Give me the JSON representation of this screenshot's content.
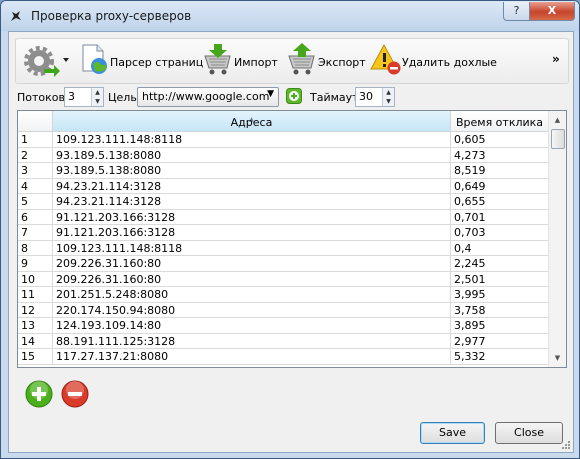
{
  "window": {
    "title": "Проверка proxy-серверов",
    "help_label": "?",
    "close_label": "X"
  },
  "toolbar": {
    "parser_label": "Парсер страниц",
    "import_label": "Импорт",
    "export_label": "Экспорт",
    "delete_dead_label": "Удалить дохлые",
    "more_label": "»"
  },
  "settings": {
    "threads_label": "Потоков",
    "threads_value": "3",
    "target_label": "Цель",
    "target_value": "http://www.google.com",
    "timeout_label": "Таймаут",
    "timeout_value": "30"
  },
  "table": {
    "columns": [
      "Адреса",
      "Время отклика"
    ],
    "rows": [
      {
        "n": "1",
        "address": "109.123.111.148:8118",
        "time": "0,605"
      },
      {
        "n": "2",
        "address": "93.189.5.138:8080",
        "time": "4,273"
      },
      {
        "n": "3",
        "address": "93.189.5.138:8080",
        "time": "8,519"
      },
      {
        "n": "4",
        "address": "94.23.21.114:3128",
        "time": "0,649"
      },
      {
        "n": "5",
        "address": "94.23.21.114:3128",
        "time": "0,655"
      },
      {
        "n": "6",
        "address": "91.121.203.166:3128",
        "time": "0,701"
      },
      {
        "n": "7",
        "address": "91.121.203.166:3128",
        "time": "0,703"
      },
      {
        "n": "8",
        "address": "109.123.111.148:8118",
        "time": "0,4"
      },
      {
        "n": "9",
        "address": "209.226.31.160:80",
        "time": "2,245"
      },
      {
        "n": "10",
        "address": "209.226.31.160:80",
        "time": "2,501"
      },
      {
        "n": "11",
        "address": "201.251.5.248:8080",
        "time": "3,995"
      },
      {
        "n": "12",
        "address": "220.174.150.94:8080",
        "time": "3,758"
      },
      {
        "n": "13",
        "address": "124.193.109.14:80",
        "time": "3,895"
      },
      {
        "n": "14",
        "address": "88.191.111.125:3128",
        "time": "2,977"
      },
      {
        "n": "15",
        "address": "117.27.137.21:8080",
        "time": "5,332"
      }
    ]
  },
  "footer": {
    "save_label": "Save",
    "close_label": "Close"
  },
  "colors": {
    "add_green": "#49b01a",
    "remove_red": "#d93a2a",
    "header_highlight": "#c6e5f6"
  }
}
